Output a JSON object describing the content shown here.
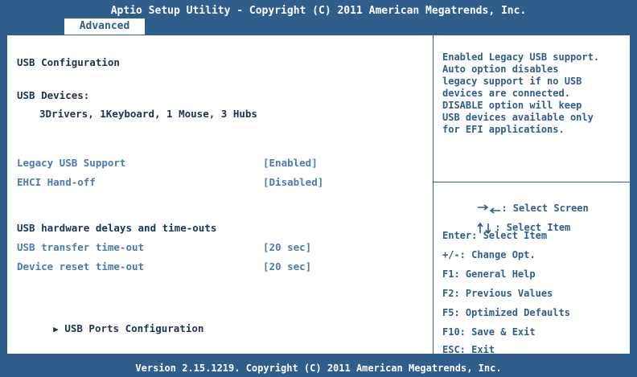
{
  "title": "Aptio Setup Utility - Copyright (C) 2011 American Megatrends, Inc.",
  "tab": "Advanced",
  "main": {
    "heading": "USB Configuration",
    "devices_label": "USB Devices:",
    "devices_value": "3Drivers, 1Keyboard, 1 Mouse, 3 Hubs",
    "items": [
      {
        "label": "Legacy USB Support",
        "value": "[Enabled]"
      },
      {
        "label": "EHCI Hand-off",
        "value": "[Disabled]"
      }
    ],
    "delays_heading": "USB hardware delays and time-outs",
    "timeouts": [
      {
        "label": "USB transfer time-out",
        "value": "[20 sec]"
      },
      {
        "label": "Device reset time-out",
        "value": "[20 sec]"
      }
    ],
    "submenu": "USB Ports Configuration"
  },
  "help": "Enabled Legacy USB support.\nAuto  option disables\nlegacy support if no USB\ndevices are connected.\nDISABLE option will keep\nUSB devices available only\nfor EFI applications.",
  "keys": {
    "select_screen": ": Select Screen",
    "select_item_arrows": ": Select Item",
    "enter": "Enter: Select Item",
    "change": "+/-: Change Opt.",
    "f1": "F1: General Help",
    "f2": "F2: Previous Values",
    "f5": "F5: Optimized Defaults",
    "f10": "F10: Save & Exit",
    "esc": "ESC: Exit"
  },
  "footer": "Version 2.15.1219. Copyright (C) 2011 American Megatrends, Inc.",
  "colors": {
    "frame": "#2f5e8c",
    "link": "#4a7ab3",
    "panel": "#ffffff"
  }
}
